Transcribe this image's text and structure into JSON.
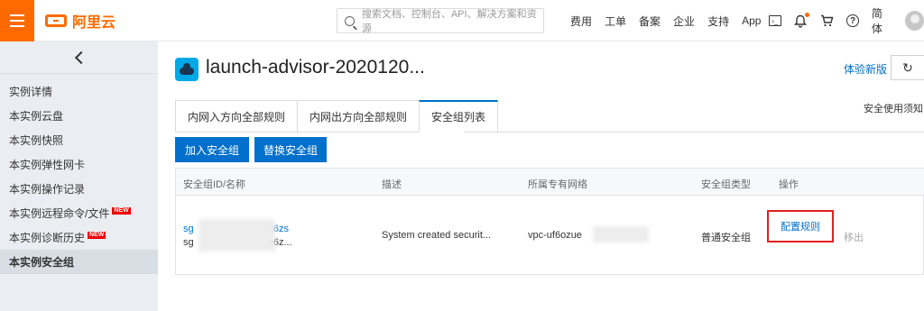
{
  "topbar": {
    "logo_text": "阿里云",
    "search_placeholder": "搜索文档、控制台、API、解决方案和资源",
    "links": [
      "费用",
      "工单",
      "备案",
      "企业",
      "支持",
      "App"
    ],
    "lang": "简体",
    "icons": [
      "terminal-icon",
      "bell-icon",
      "cart-icon",
      "help-icon",
      "avatar"
    ],
    "accent": "#ff6a00"
  },
  "sidebar": {
    "items": [
      {
        "label": "实例详情",
        "new": false
      },
      {
        "label": "本实例云盘",
        "new": false
      },
      {
        "label": "本实例快照",
        "new": false
      },
      {
        "label": "本实例弹性网卡",
        "new": false
      },
      {
        "label": "本实例操作记录",
        "new": false
      },
      {
        "label": "本实例远程命令/文件",
        "new": true
      },
      {
        "label": "本实例诊断历史",
        "new": true
      },
      {
        "label": "本实例安全组",
        "new": false
      }
    ],
    "active_index": 7,
    "new_badge": "NEW"
  },
  "header": {
    "title": "launch-advisor-2020120...",
    "try_new": "体验新版",
    "refresh_icon": "↻"
  },
  "tabs": [
    "内网入方向全部规则",
    "内网出方向全部规则",
    "安全组列表"
  ],
  "active_tab": 2,
  "notice": "安全使用须知",
  "buttons": {
    "add": "加入安全组",
    "replace": "替换安全组"
  },
  "table": {
    "headers": [
      "安全组ID/名称",
      "描述",
      "所属专有网络",
      "安全组类型",
      "操作"
    ],
    "row": {
      "id_prefix": "sg",
      "id_suffix": "3n6zs",
      "name_prefix": "sg",
      "name_suffix": "3n6z...",
      "description": "System created securit...",
      "vpc_prefix": "vpc-uf6ozue",
      "vpc_suffix": "3",
      "type": "普通安全组",
      "action_configure": "配置规则",
      "action_remove": "移出"
    }
  },
  "colors": {
    "link": "#0070cc",
    "highlight": "#e02020"
  }
}
